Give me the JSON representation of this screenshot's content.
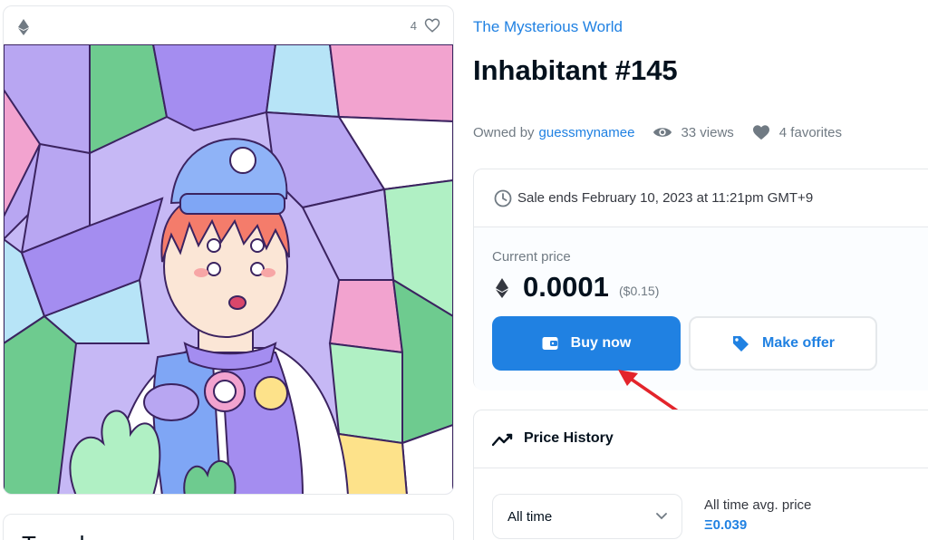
{
  "nft_card": {
    "favorite_count": "4",
    "below_card_text": "T... ...l..."
  },
  "collection": {
    "name": "The Mysterious World"
  },
  "item": {
    "title": "Inhabitant #145",
    "owned_by_label": "Owned by",
    "owner": "guessmynamee",
    "views": "33 views",
    "favorites": "4 favorites"
  },
  "sale": {
    "ends_text": "Sale ends February 10, 2023 at 11:21pm GMT+9",
    "current_price_label": "Current price",
    "price": "0.0001",
    "price_usd": "($0.15)",
    "buy_label": "Buy now",
    "offer_label": "Make offer"
  },
  "price_history": {
    "title": "Price History",
    "time_filter": "All time",
    "avg_label": "All time avg. price",
    "avg_value": "Ξ0.039"
  },
  "colors": {
    "accent": "#2081e2",
    "annotation_arrow": "#e3242b"
  },
  "icons": [
    "ethereum-icon",
    "heart-outline-icon",
    "eye-icon",
    "heart-filled-icon",
    "clock-icon",
    "wallet-icon",
    "tag-icon",
    "trend-icon",
    "chevron-down-icon"
  ]
}
